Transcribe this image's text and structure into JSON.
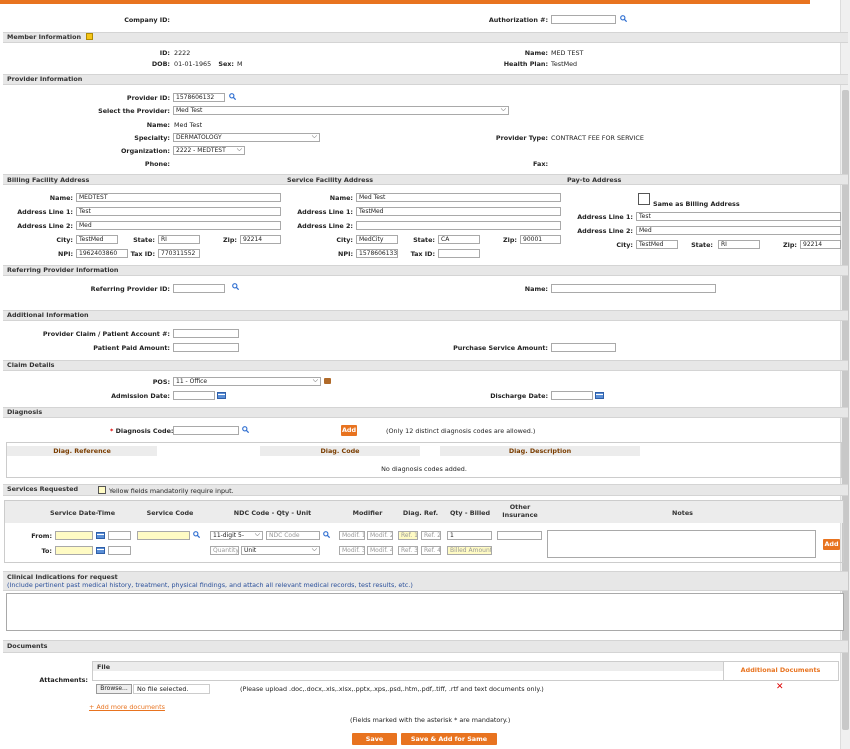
{
  "company": {
    "label": "Company ID:",
    "auth_label": "Authorization #:"
  },
  "member": {
    "title": "Member Information",
    "id_label": "ID:",
    "id": "2222",
    "name_label": "Name:",
    "name": "MED TEST",
    "dob_label": "DOB:",
    "dob": "01-01-1965",
    "sex_label": "Sex:",
    "sex": "M",
    "plan_label": "Health Plan:",
    "plan": "TestMed"
  },
  "provider": {
    "title": "Provider Information",
    "id_label": "Provider ID:",
    "id": "1578606132",
    "select_label": "Select the Provider:",
    "select_value": "Med Test",
    "name_label": "Name:",
    "name": "Med Test",
    "specialty_label": "Specialty:",
    "specialty": "DERMATOLOGY",
    "type_label": "Provider Type:",
    "type": "CONTRACT FEE FOR SERVICE",
    "org_label": "Organization:",
    "org": "2222 - MEDTEST",
    "phone_label": "Phone:",
    "fax_label": "Fax:"
  },
  "billing": {
    "title": "Billing Facility Address",
    "name_label": "Name:",
    "name": "MEDTEST",
    "addr1_label": "Address Line 1:",
    "addr1": "Test",
    "addr2_label": "Address Line 2:",
    "addr2": "Med",
    "city_label": "City:",
    "city": "TestMed",
    "state_label": "State:",
    "state": "RI",
    "zip_label": "Zip:",
    "zip": "92214",
    "npi_label": "NPI:",
    "npi": "1962403860",
    "tax_label": "Tax ID:",
    "tax": "770311552"
  },
  "service": {
    "title": "Service Facility Address",
    "name_label": "Name:",
    "name": "Med Test",
    "addr1_label": "Address Line 1:",
    "addr1": "TestMed",
    "addr2_label": "Address Line 2:",
    "addr2": "",
    "city_label": "City:",
    "city": "MedCity",
    "state_label": "State:",
    "state": "CA",
    "zip_label": "Zip:",
    "zip": "90001",
    "npi_label": "NPI:",
    "npi": "1578606133",
    "tax_label": "Tax ID:",
    "tax": ""
  },
  "payto": {
    "title": "Pay-to Address",
    "same_label": "Same as Billing Address",
    "addr1_label": "Address Line 1:",
    "addr1": "Test",
    "addr2_label": "Address Line 2:",
    "addr2": "Med",
    "city_label": "City:",
    "city": "TestMed",
    "state_label": "State:",
    "state": "RI",
    "zip_label": "Zip:",
    "zip": "92214"
  },
  "referring": {
    "title": "Referring Provider Information",
    "id_label": "Referring Provider ID:",
    "name_label": "Name:"
  },
  "additional": {
    "title": "Additional Information",
    "claim_label": "Provider Claim / Patient Account #:",
    "paid_label": "Patient Paid Amount:",
    "purchase_label": "Purchase Service Amount:"
  },
  "claim": {
    "title": "Claim Details",
    "pos_label": "POS:",
    "pos": "11 - Office",
    "admission_label": "Admission Date:",
    "discharge_label": "Discharge Date:"
  },
  "diagnosis": {
    "title": "Diagnosis",
    "code_label": "Diagnosis Code:",
    "asterisk": "*",
    "add_label": "Add",
    "note": "(Only 12 distinct diagnosis codes are allowed.)",
    "columns": [
      "Diag. Reference",
      "Diag. Code",
      "Diag. Description"
    ],
    "empty": "No diagnosis codes added."
  },
  "services": {
    "title": "Services Requested",
    "yellow_note": "Yellow fields mandatorily require input.",
    "columns": [
      "Service Date-Time",
      "Service Code",
      "NDC Code - Qty - Unit",
      "Modifier",
      "Diag. Ref.",
      "Qty - Billed",
      "Other Insurance",
      "Notes"
    ],
    "from_label": "From:",
    "to_label": "To:",
    "ndc_type": "11-digit 5-",
    "ndc_placeholder": "NDC Code",
    "qty_placeholder": "Quantity",
    "unit": "Unit",
    "modifiers": [
      "Modif. 1",
      "Modif. 2",
      "Modif. 3",
      "Modif. 4"
    ],
    "refs": [
      "Ref. 1",
      "Ref. 2",
      "Ref. 3",
      "Ref. 4"
    ],
    "qty": "1",
    "billed_placeholder": "Billed Amount",
    "add_label": "Add"
  },
  "clinical": {
    "title": "Clinical Indications for request",
    "subtitle": "(Include pertinent past medical history, treatment, physical findings, and attach all relevant medical records, test results, etc.)"
  },
  "documents": {
    "title": "Documents",
    "attach_label": "Attachments:",
    "file_col": "File",
    "additional_col": "Additional Documents",
    "browse": "Browse...",
    "no_file": "No file selected.",
    "upload_note": "(Please upload .doc,.docx,.xls,.xlsx,.pptx,.xps,.psd,.htm,.pdf,.tiff, .rtf and text documents only.)",
    "add_more": "+ Add more documents",
    "remove_icon": "✕"
  },
  "footer": {
    "mandatory_note": "(Fields marked with the asterisk * are mandatory.)",
    "save": "Save",
    "save_add": "Save & Add for Same Member"
  }
}
